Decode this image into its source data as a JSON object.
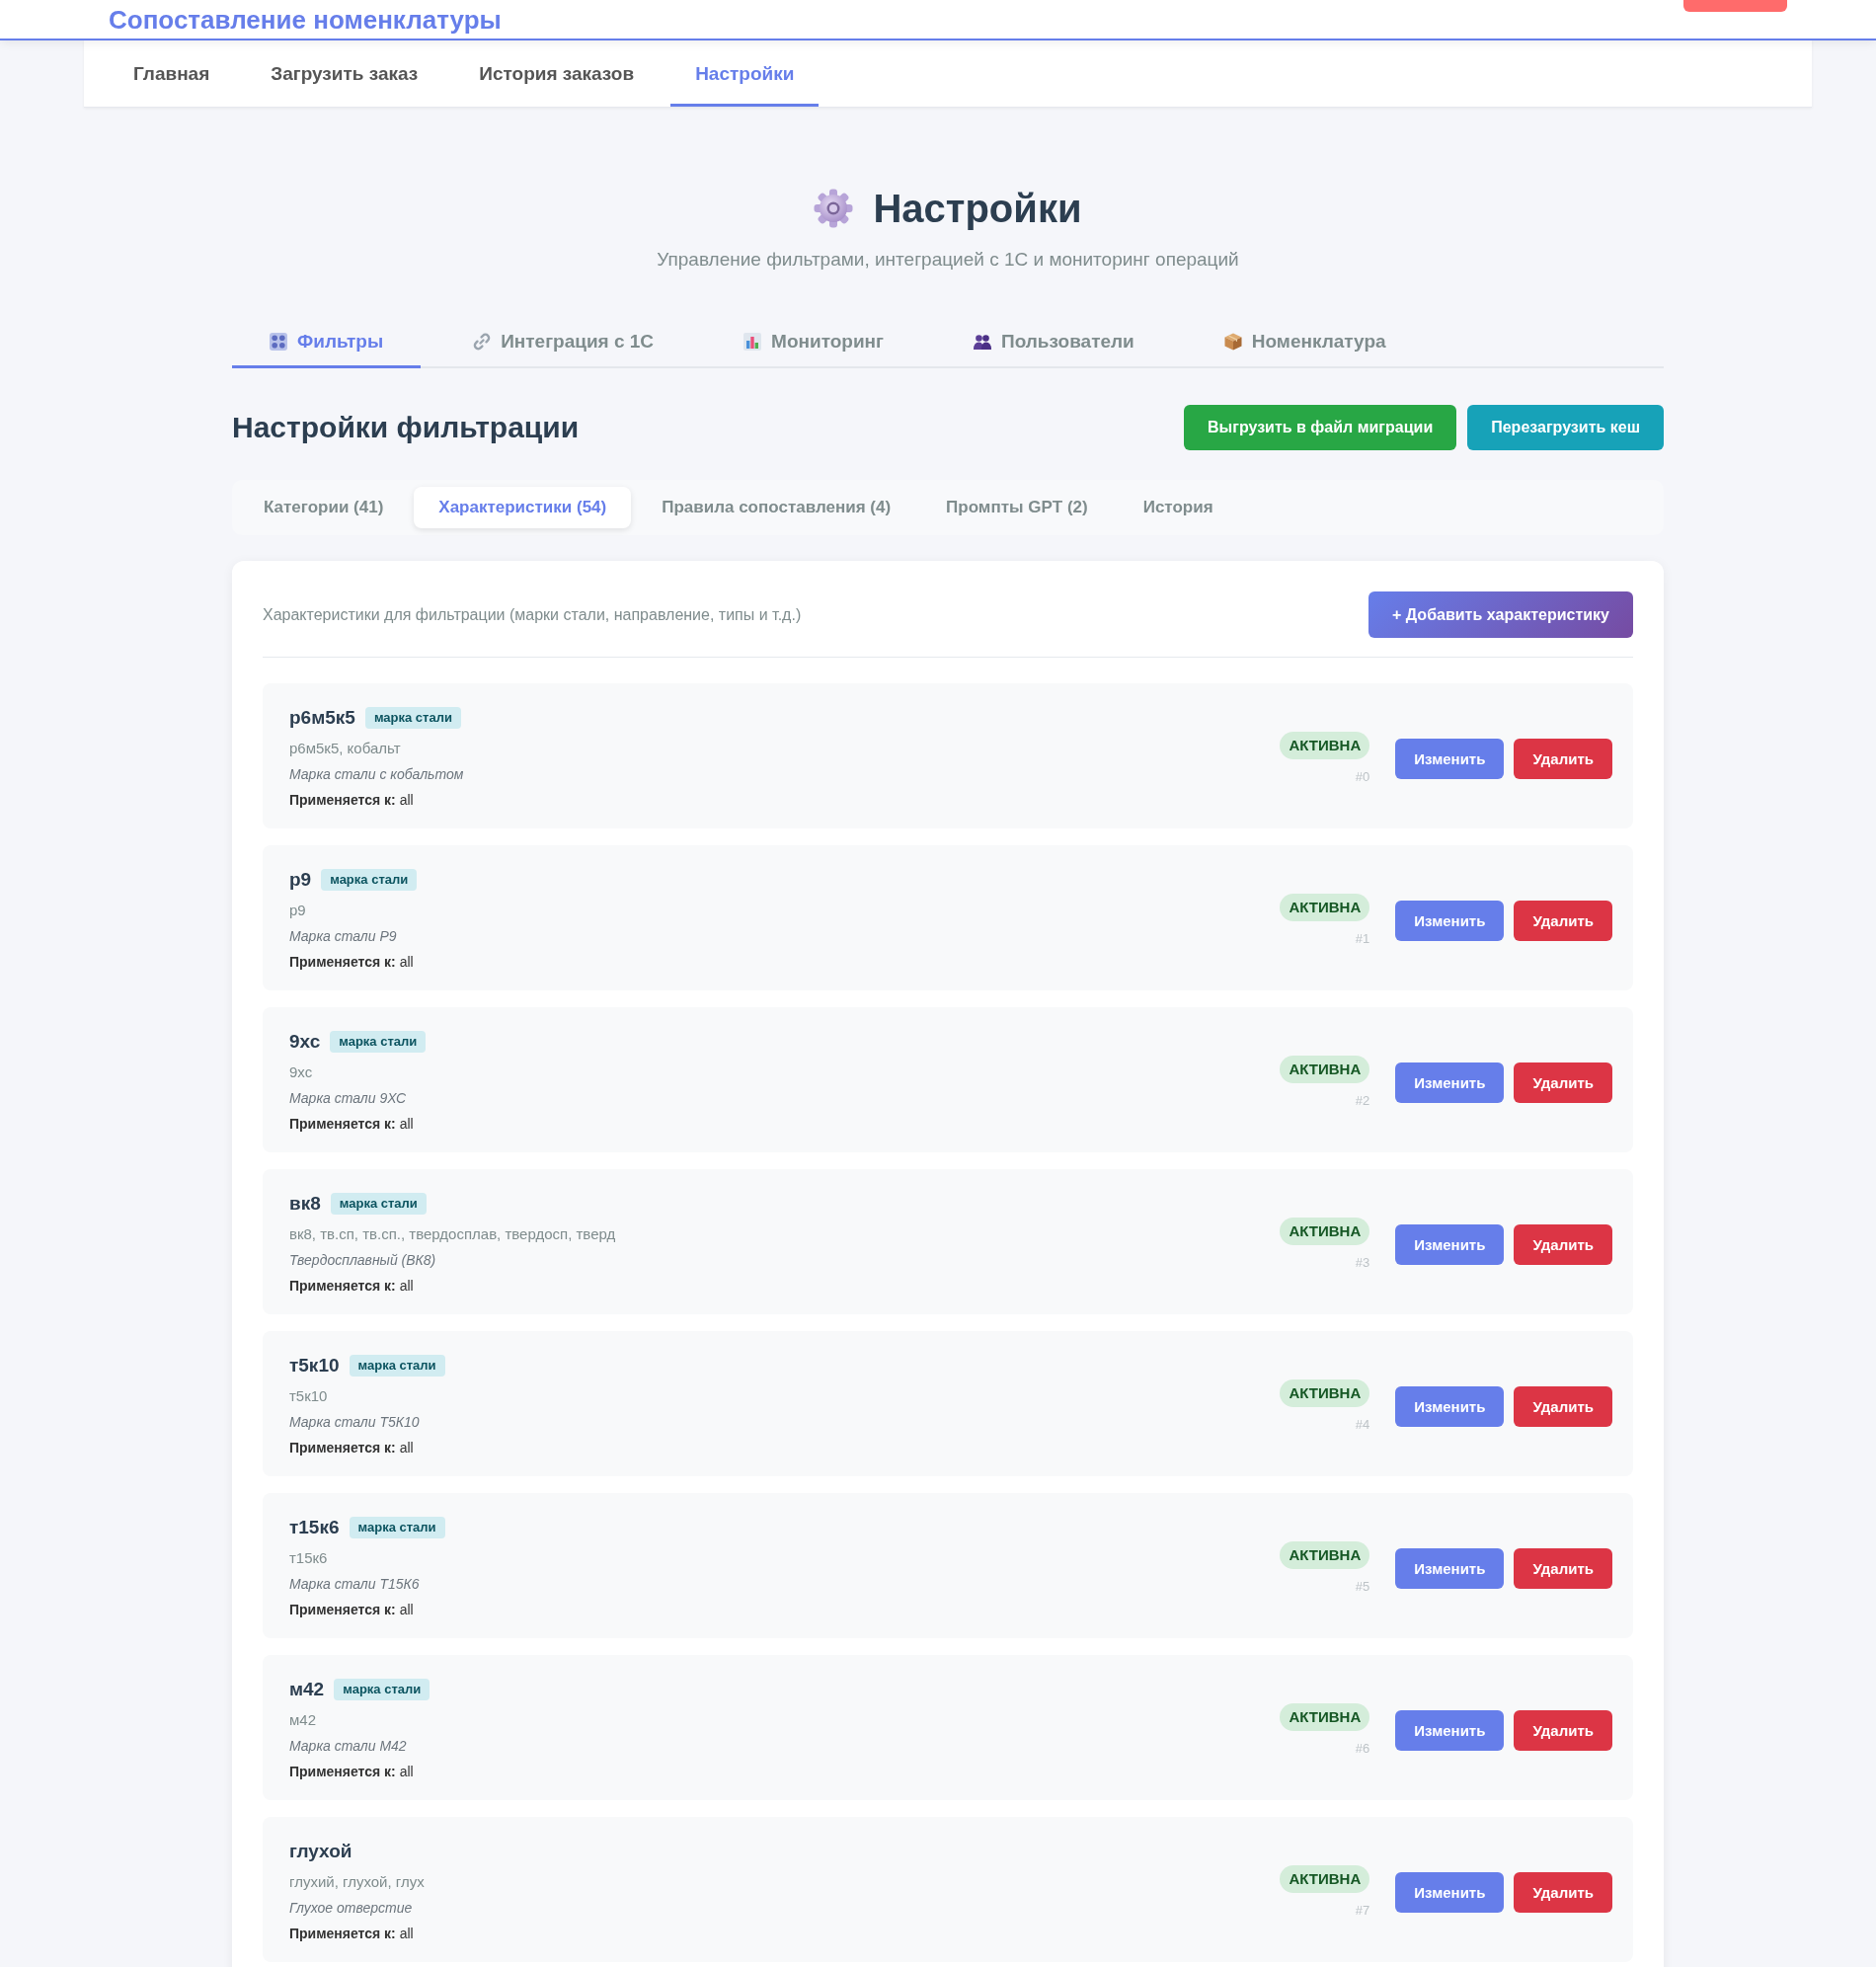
{
  "header": {
    "title": "Сопоставление номенклатуры"
  },
  "nav": [
    {
      "label": "Главная",
      "selected": false
    },
    {
      "label": "Загрузить заказ",
      "selected": false
    },
    {
      "label": "История заказов",
      "selected": false
    },
    {
      "label": "Настройки",
      "selected": true
    }
  ],
  "page": {
    "title": "Настройки",
    "subtitle": "Управление фильтрами, интеграцией с 1С и мониторинг операций"
  },
  "tabs": [
    {
      "label": "Фильтры",
      "selected": true
    },
    {
      "label": "Интеграция с 1С",
      "selected": false
    },
    {
      "label": "Мониторинг",
      "selected": false
    },
    {
      "label": "Пользователи",
      "selected": false
    },
    {
      "label": "Номенклатура",
      "selected": false
    }
  ],
  "section": {
    "title": "Настройки фильтрации",
    "buttons": [
      {
        "label": "Выгрузить в файл миграции",
        "kind": "success"
      },
      {
        "label": "Перезагрузить кеш",
        "kind": "info"
      }
    ]
  },
  "subtabs": [
    {
      "label": "Категории (41)",
      "selected": false
    },
    {
      "label": "Характеристики (54)",
      "selected": true
    },
    {
      "label": "Правила сопоставления (4)",
      "selected": false
    },
    {
      "label": "Промпты GPT (2)",
      "selected": false
    },
    {
      "label": "История",
      "selected": false
    }
  ],
  "panel": {
    "description": "Характеристики для фильтрации (марки стали, направление, типы и т.д.)",
    "add_button": "+ Добавить характеристику",
    "items": [
      {
        "name": "р6м5к5",
        "tag": "марка стали",
        "synonyms": "р6м5к5, кобальт",
        "description": "Марка стали с кобальтом",
        "applies": "**Применяется к:** all",
        "status": "АКТИВНА",
        "active": true,
        "number": "#0",
        "edit_button": "Изменить",
        "delete_button": "Удалить"
      },
      {
        "name": "р9",
        "tag": "марка стали",
        "synonyms": "р9",
        "description": "Марка стали Р9",
        "applies": "**Применяется к:** all",
        "status": "АКТИВНА",
        "active": true,
        "number": "#1",
        "edit_button": "Изменить",
        "delete_button": "Удалить"
      },
      {
        "name": "9хс",
        "tag": "марка стали",
        "synonyms": "9хс",
        "description": "Марка стали 9ХС",
        "applies": "**Применяется к:** all",
        "status": "АКТИВНА",
        "active": true,
        "number": "#2",
        "edit_button": "Изменить",
        "delete_button": "Удалить"
      },
      {
        "name": "вк8",
        "tag": "марка стали",
        "synonyms": "вк8, тв.сп, тв.сп., твердосплав, твердосп, тверд",
        "description": "Твердосплавный (ВК8)",
        "applies": "**Применяется к:** all",
        "status": "АКТИВНА",
        "active": true,
        "number": "#3",
        "edit_button": "Изменить",
        "delete_button": "Удалить"
      },
      {
        "name": "т5к10",
        "tag": "марка стали",
        "synonyms": "т5к10",
        "description": "Марка стали Т5К10",
        "applies": "**Применяется к:** all",
        "status": "АКТИВНА",
        "active": true,
        "number": "#4",
        "edit_button": "Изменить",
        "delete_button": "Удалить"
      },
      {
        "name": "т15к6",
        "tag": "марка стали",
        "synonyms": "т15к6",
        "description": "Марка стали Т15К6",
        "applies": "**Применяется к:** all",
        "status": "АКТИВНА",
        "active": true,
        "number": "#5",
        "edit_button": "Изменить",
        "delete_button": "Удалить"
      },
      {
        "name": "м42",
        "tag": "марка стали",
        "synonyms": "м42",
        "description": "Марка стали М42",
        "applies": "**Применяется к:** all",
        "status": "АКТИВНА",
        "active": true,
        "number": "#6",
        "edit_button": "Изменить",
        "delete_button": "Удалить"
      },
      {
        "name": "глухой",
        "synonyms": "глухий, глухой, глух",
        "description": "Глухое отверстие",
        "applies": "**Применяется к:** all",
        "status": "АКТИВНА",
        "active": true,
        "number": "#7",
        "edit_button": "Изменить",
        "delete_button": "Удалить"
      }
    ]
  }
}
